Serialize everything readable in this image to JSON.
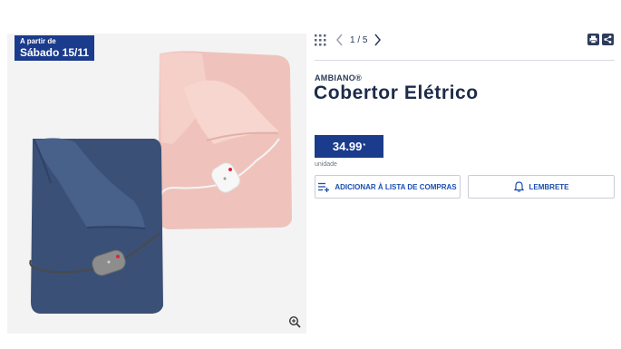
{
  "badge": {
    "line1": "A partir de",
    "line2": "Sábado 15/11"
  },
  "gallery": {
    "counter": "1 / 5"
  },
  "product": {
    "brand": "AMBIANO®",
    "title": "Cobertor Elétrico",
    "price": "34.99",
    "price_mark": "*",
    "unit": "unidade"
  },
  "actions": {
    "add_to_list": "ADICIONAR À LISTA DE COMPRAS",
    "reminder": "LEMBRETE"
  },
  "icons": {
    "grid": "grid-icon",
    "prev": "chevron-left-icon",
    "next": "chevron-right-icon",
    "print": "print-icon",
    "share": "share-icon",
    "zoom": "zoom-icon",
    "list": "list-add-icon",
    "bell": "bell-icon"
  },
  "colors": {
    "brand_blue": "#1b3b8c",
    "link_blue": "#1b4fb0",
    "navy_blanket": "#3a5077",
    "pink_blanket": "#efc3bb"
  }
}
